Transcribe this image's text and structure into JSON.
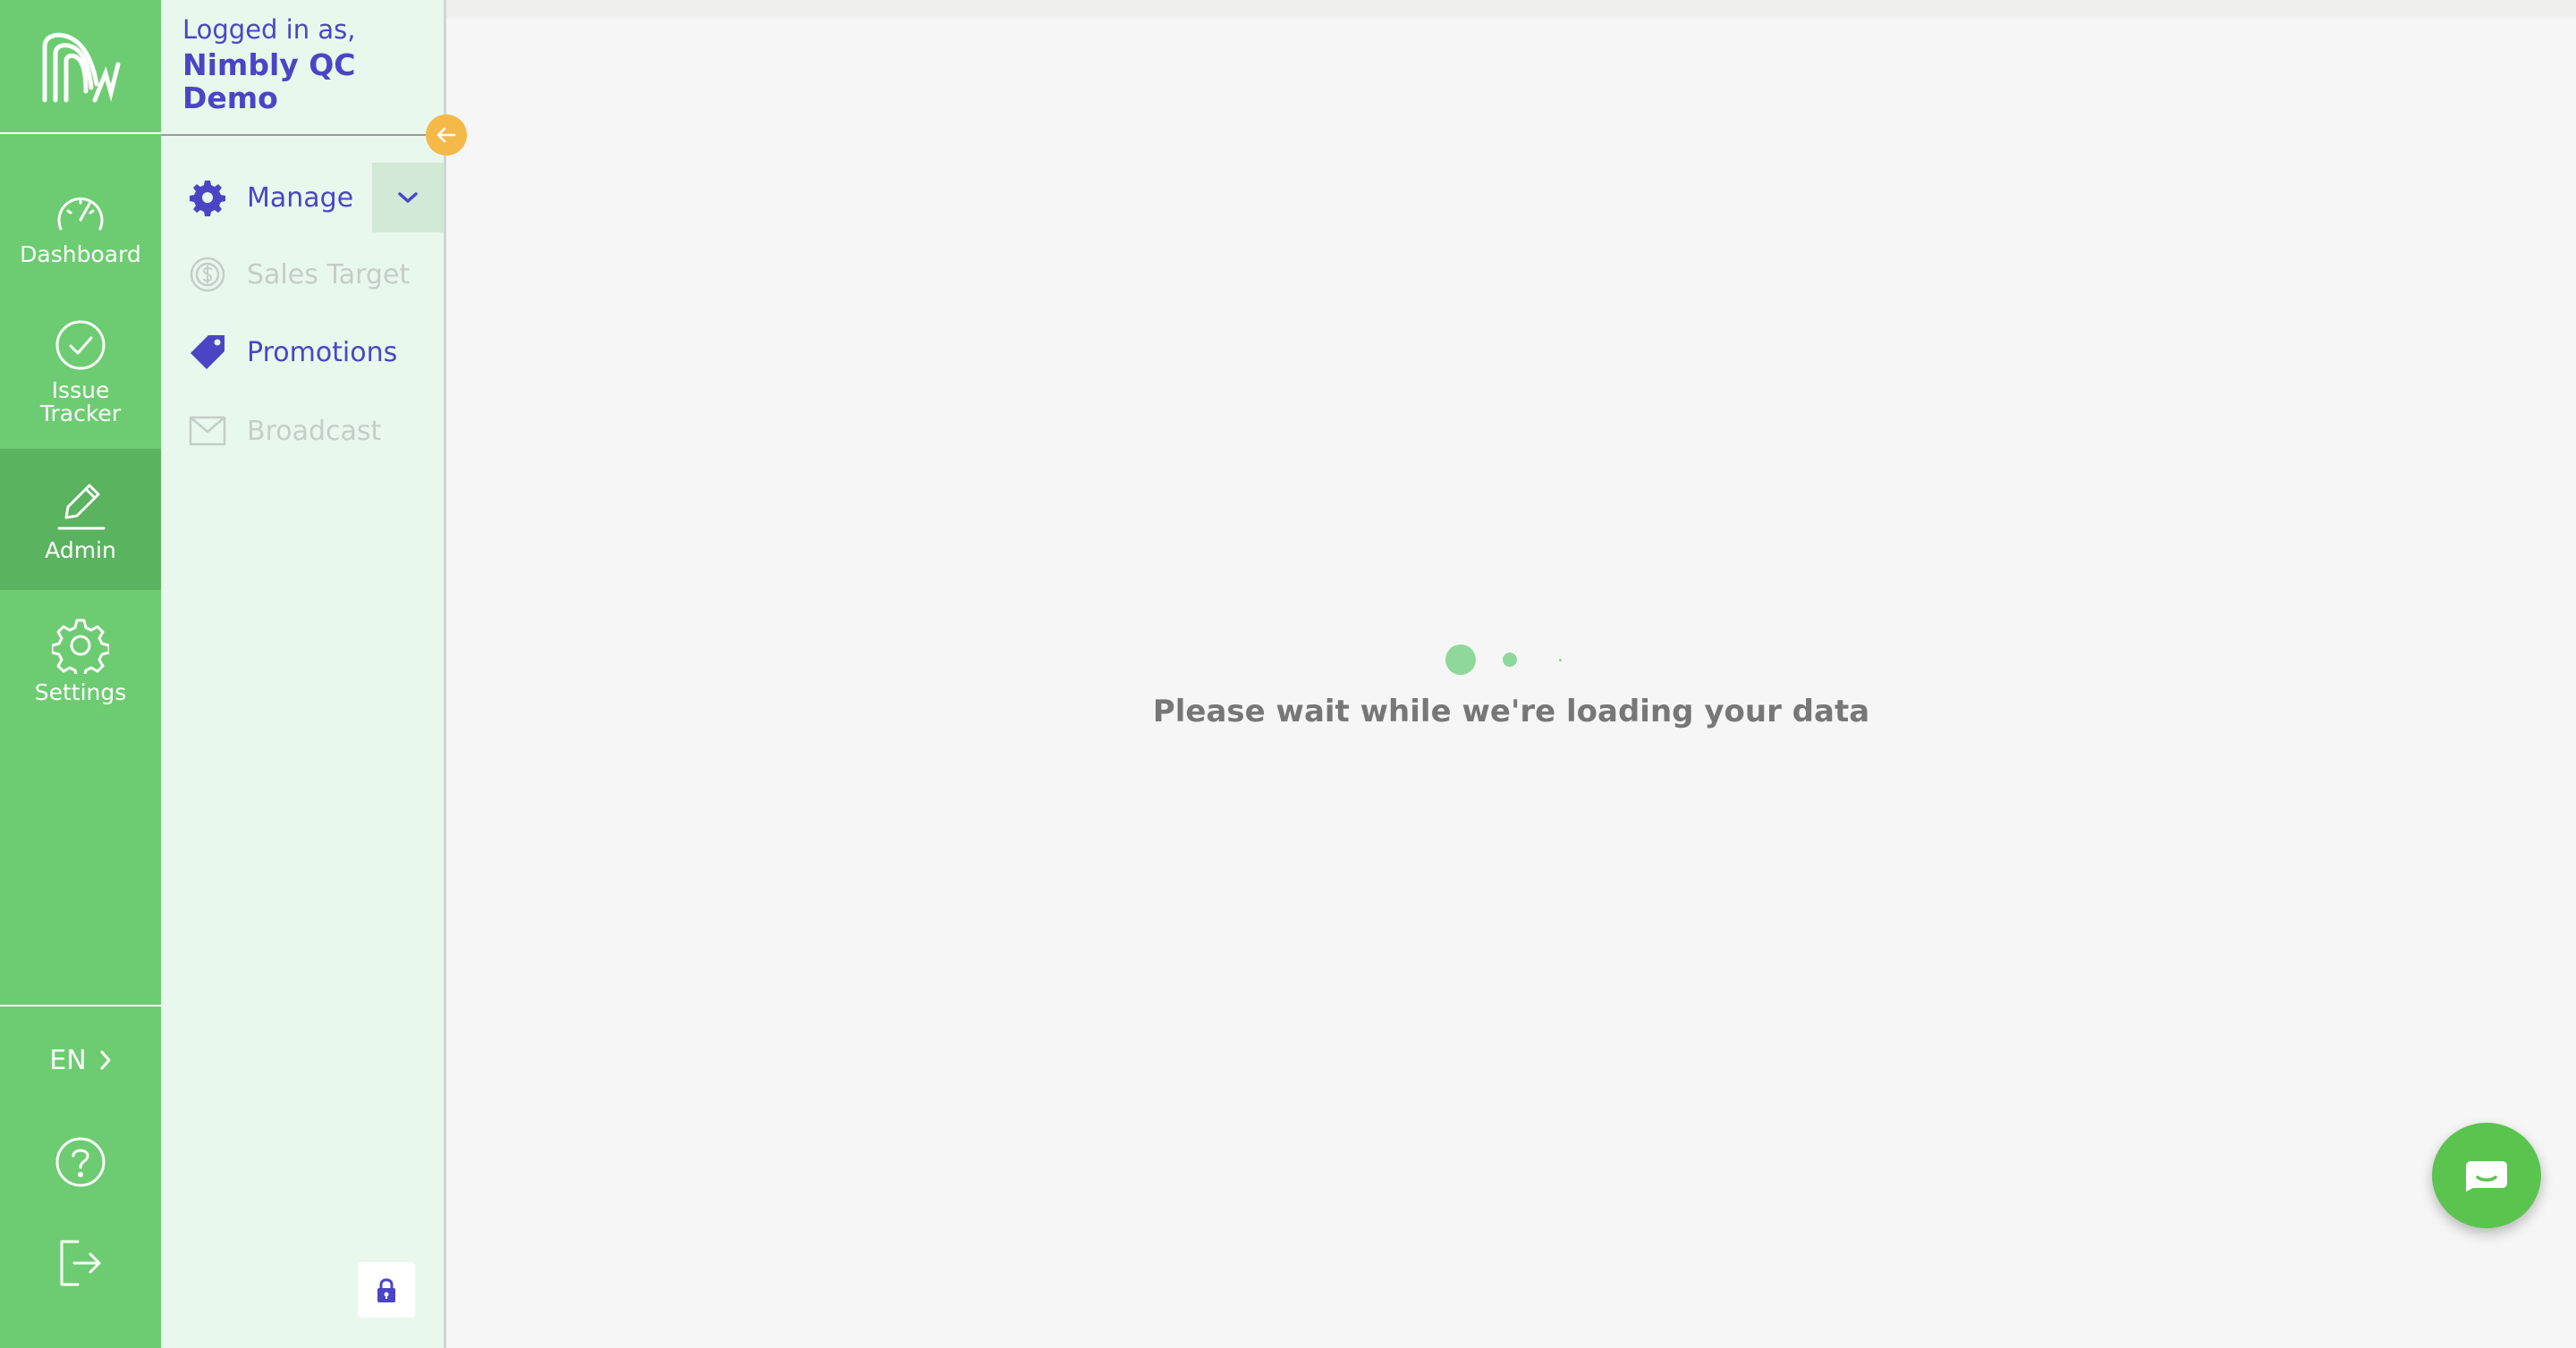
{
  "rail": {
    "items": [
      {
        "label": "Dashboard",
        "icon": "gauge-icon"
      },
      {
        "label": "Issue\nTracker",
        "icon": "check-circle-icon"
      },
      {
        "label": "Admin",
        "icon": "pencil-icon",
        "active": true
      },
      {
        "label": "Settings",
        "icon": "gear-icon"
      }
    ],
    "language": "EN"
  },
  "user": {
    "logged_in_label": "Logged in as,",
    "name": "Nimbly QC Demo"
  },
  "admin_menu": {
    "manage": "Manage",
    "sales_target": "Sales Target",
    "promotions": "Promotions",
    "broadcast": "Broadcast"
  },
  "main": {
    "loading_text": "Please wait while we're loading your data"
  },
  "colors": {
    "rail_green": "#6dcc71",
    "accent_purple": "#4b45c6",
    "panel_bg": "#e8f8ec",
    "collapse_orange": "#f5b94a",
    "chat_green": "#5ac44f"
  }
}
